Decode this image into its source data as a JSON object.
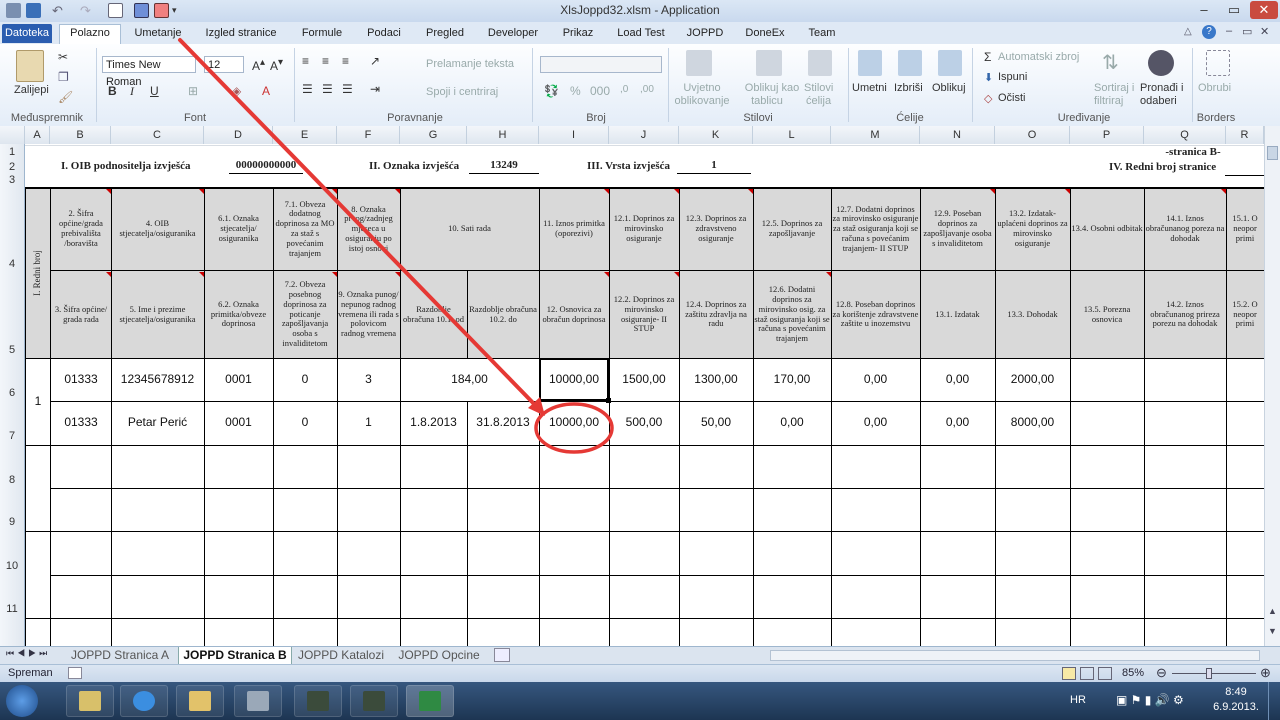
{
  "window": {
    "title": "XlsJoppd32.xlsm - Application"
  },
  "ribbon_tabs": [
    {
      "label": "Datoteka"
    },
    {
      "label": "Polazno"
    },
    {
      "label": "Umetanje"
    },
    {
      "label": "Izgled stranice"
    },
    {
      "label": "Formule"
    },
    {
      "label": "Podaci"
    },
    {
      "label": "Pregled"
    },
    {
      "label": "Developer"
    },
    {
      "label": "Prikaz"
    },
    {
      "label": "Load Test"
    },
    {
      "label": "JOPPD"
    },
    {
      "label": "DoneEx"
    },
    {
      "label": "Team"
    }
  ],
  "ribbon": {
    "paste": "Zalijepi",
    "clipboard_group": "Međuspremnik",
    "font_name": "Times New Roman",
    "font_size": "12",
    "font_group": "Font",
    "wrap_text": "Prelamanje teksta",
    "merge_center": "Spoji i centriraj",
    "alignment_group": "Poravnanje",
    "number_group": "Broj",
    "cond_format": "Uvjetno",
    "cond_format2": "oblikovanje",
    "format_table": "Oblikuj kao",
    "format_table2": "tablicu",
    "cell_styles": "Stilovi",
    "cell_styles2": "ćelija",
    "styles_group": "Stilovi",
    "insert": "Umetni",
    "delete": "Izbriši",
    "format": "Oblikuj",
    "cells_group": "Ćelije",
    "autosum": "Automatski zbroj",
    "fill": "Ispuni",
    "clear": "Očisti",
    "sort_filter": "Sortiraj i",
    "sort_filter2": "filtriraj",
    "find_select": "Pronađi i",
    "find_select2": "odaberi",
    "editing_group": "Uređivanje",
    "borders": "Obrubi",
    "borders_group": "Borders"
  },
  "columns": [
    "A",
    "B",
    "C",
    "D",
    "E",
    "F",
    "G",
    "H",
    "I",
    "J",
    "K",
    "L",
    "M",
    "N",
    "O",
    "P",
    "Q",
    "R"
  ],
  "rows": [
    "1",
    "2",
    "3",
    "4",
    "5",
    "6",
    "7",
    "8",
    "9",
    "10",
    "11"
  ],
  "form": {
    "oib_label": "I. OIB podnositelja izvješća",
    "oib_value": "00000000000",
    "oznaka_label": "II. Oznaka izvješća",
    "oznaka_value": "13249",
    "vrsta_label": "III. Vrsta izvješća",
    "vrsta_value": "1",
    "stranica": "-stranica B-",
    "redni_broj_stranice": "IV. Redni broj stranice",
    "redni_broj_col": "I. Redni broj"
  },
  "header_top": [
    "2. Šifra općine/grada prebivališta /boravišta",
    "4. OIB stjecatelja/osiguranika",
    "6.1. Oznaka stjecatelja/ osiguranika",
    "7.1. Obveza dodatnog doprinosa za MO za staž s povećanim trajanjem",
    "8. Oznaka prvog/zadnjeg mjeseca u osiguranju po istoj osnovi",
    "10. Sati rada",
    "11. Iznos primitka (oporezivi)",
    "12.1. Doprinos za mirovinsko osiguranje",
    "12.3. Doprinos za zdravstveno osiguranje",
    "12.5. Doprinos za zapošljavanje",
    "12.7. Dodatni doprinos za mirovinsko osiguranje za staž osiguranja koji se računa s povećanim trajanjem- II STUP",
    "12.9. Poseban doprinos za zapošljavanje osoba s invaliditetom",
    "13.2. Izdatak- uplaćeni doprinos za mirovinsko osiguranje",
    "13.4. Osobni odbitak",
    "14.1. Iznos obračunanog poreza na dohodak",
    "15.1. O neopor primi"
  ],
  "header_bottom": [
    "3. Šifra općine/ grada rada",
    "5. Ime i prezime stjecatelja/osiguranika",
    "6.2. Oznaka primitka/obveze doprinosa",
    "7.2. Obveza posebnog doprinosa za poticanje zapošljavanja osoba s invaliditetom",
    "9. Oznaka punog/ nepunog radnog vremena ili rada s polovicom radnog vremena",
    "Razdoblje obračuna 10.1. od",
    "Razdoblje obračuna 10.2. do",
    "12. Osnovica za obračun doprinosa",
    "12.2. Doprinos za mirovinsko osiguranje- II STUP",
    "12.4. Doprinos za zaštitu zdravlja na radu",
    "12.6. Dodatni doprinos za mirovinsko osig. za staž osiguranja koji se računa s povećanim trajanjem",
    "12.8. Poseban doprinos za korištenje zdravstvene zaštite u inozemstvu",
    "13.1. Izdatak",
    "13.3. Dohodak",
    "13.5. Porezna osnovica",
    "14.2. Iznos obračunanog prireza porezu na dohodak",
    "15.2. O neopor primi"
  ],
  "record": {
    "redni_broj": "1",
    "row6": [
      "01333",
      "12345678912",
      "0001",
      "0",
      "3",
      "184,00",
      "10000,00",
      "1500,00",
      "1300,00",
      "170,00",
      "0,00",
      "0,00",
      "2000,00"
    ],
    "row7": [
      "01333",
      "Petar Perić",
      "0001",
      "0",
      "1",
      "1.8.2013",
      "31.8.2013",
      "10000,00",
      "500,00",
      "50,00",
      "0,00",
      "0,00",
      "0,00",
      "8000,00"
    ]
  },
  "sheet_tabs": [
    {
      "label": "JOPPD Stranica A"
    },
    {
      "label": "JOPPD Stranica B"
    },
    {
      "label": "JOPPD Katalozi"
    },
    {
      "label": "JOPPD Opcine"
    }
  ],
  "status": {
    "ready": "Spreman",
    "zoom": "85%"
  },
  "taskbar": {
    "lang": "HR",
    "time": "8:49",
    "date": "6.9.2013."
  },
  "colors": {
    "accent_file_tab": "#2a5db0",
    "annotation": "#e53935",
    "header_fill": "#d9d9d9"
  }
}
